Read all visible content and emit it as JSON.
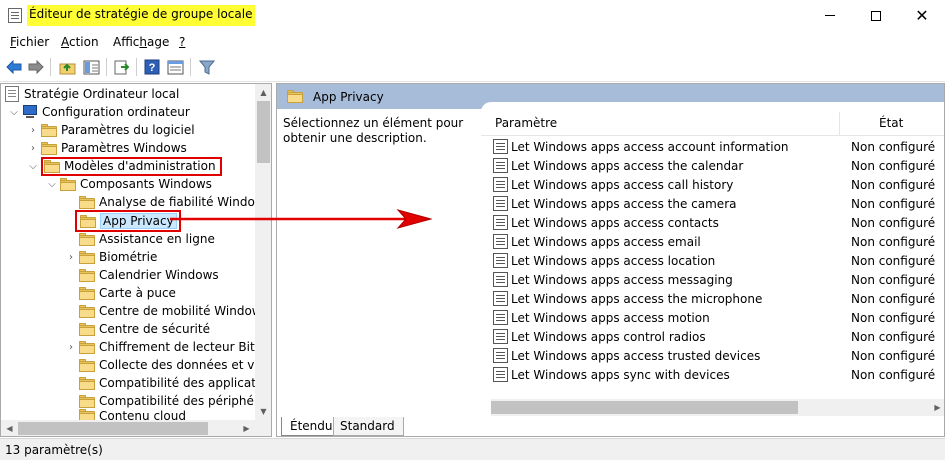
{
  "window": {
    "title": "Éditeur de stratégie de groupe locale",
    "controls": {
      "minimize": "minimize-icon",
      "maximize": "maximize-icon",
      "close": "close-icon"
    }
  },
  "menu": {
    "items": [
      {
        "label": "Fichier",
        "accel": "F",
        "rest": "ichier"
      },
      {
        "label": "Action",
        "accel": "A",
        "rest": "ction"
      },
      {
        "label": "Affichage",
        "pre": "Affic",
        "accel": "h",
        "rest": "age"
      },
      {
        "label": "?",
        "accel": "?",
        "rest": ""
      }
    ]
  },
  "toolbar": {
    "buttons": [
      "back-arrow-icon",
      "forward-arrow-icon",
      "up-folder-icon",
      "show-hide-tree-icon",
      "export-list-icon",
      "help-icon",
      "properties-view-icon",
      "filter-icon"
    ]
  },
  "tree": {
    "items": [
      {
        "label": "Stratégie Ordinateur local"
      },
      {
        "label": "Configuration ordinateur"
      },
      {
        "label": "Paramètres du logiciel"
      },
      {
        "label": "Paramètres Windows"
      },
      {
        "label": "Modèles d'administration"
      },
      {
        "label": "Composants Windows"
      },
      {
        "label": "Analyse de fiabilité Windows"
      },
      {
        "label": "App Privacy"
      },
      {
        "label": "Assistance en ligne"
      },
      {
        "label": "Biométrie"
      },
      {
        "label": "Calendrier Windows"
      },
      {
        "label": "Carte à puce"
      },
      {
        "label": "Centre de mobilité Windows"
      },
      {
        "label": "Centre de sécurité"
      },
      {
        "label": "Chiffrement de lecteur BitLo"
      },
      {
        "label": "Collecte des données et vers"
      },
      {
        "label": "Compatibilité des application"
      },
      {
        "label": "Compatibilité des périphériq"
      },
      {
        "label": "Contenu cloud"
      }
    ]
  },
  "details": {
    "header_title": "App Privacy",
    "description": "Sélectionnez un élément pour obtenir une description.",
    "columns": {
      "name": "Paramètre",
      "state": "État"
    },
    "rows": [
      {
        "name": "Let Windows apps access account information",
        "state": "Non configuré"
      },
      {
        "name": "Let Windows apps access the calendar",
        "state": "Non configuré"
      },
      {
        "name": "Let Windows apps access call history",
        "state": "Non configuré"
      },
      {
        "name": "Let Windows apps access the camera",
        "state": "Non configuré"
      },
      {
        "name": "Let Windows apps access contacts",
        "state": "Non configuré"
      },
      {
        "name": "Let Windows apps access email",
        "state": "Non configuré"
      },
      {
        "name": "Let Windows apps access location",
        "state": "Non configuré"
      },
      {
        "name": "Let Windows apps access messaging",
        "state": "Non configuré"
      },
      {
        "name": "Let Windows apps access the microphone",
        "state": "Non configuré"
      },
      {
        "name": "Let Windows apps access motion",
        "state": "Non configuré"
      },
      {
        "name": "Let Windows apps control radios",
        "state": "Non configuré"
      },
      {
        "name": "Let Windows apps access trusted devices",
        "state": "Non configuré"
      },
      {
        "name": "Let Windows apps sync with devices",
        "state": "Non configuré"
      }
    ],
    "tabs": {
      "extended": "Étendu",
      "standard": "Standard"
    }
  },
  "status": {
    "text": "13 paramètre(s)"
  },
  "colors": {
    "title_highlight": "#ffff33",
    "annotation_red": "#e00000",
    "header_band": "#a6bcd9",
    "selection": "#cce8ff"
  }
}
